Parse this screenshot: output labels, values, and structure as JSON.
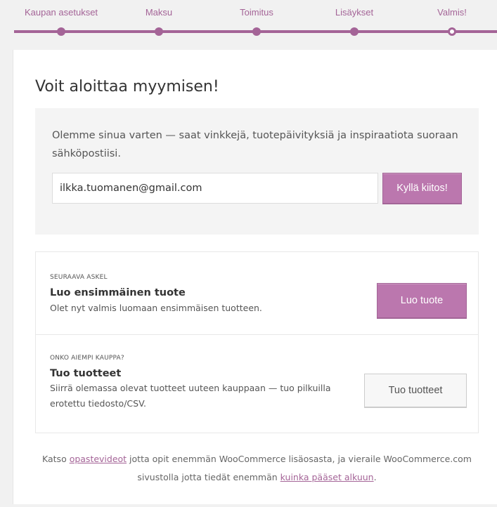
{
  "steps": [
    {
      "label": "Kaupan asetukset",
      "state": "done"
    },
    {
      "label": "Maksu",
      "state": "done"
    },
    {
      "label": "Toimitus",
      "state": "done"
    },
    {
      "label": "Lisäykset",
      "state": "done"
    },
    {
      "label": "Valmis!",
      "state": "current"
    }
  ],
  "page": {
    "title": "Voit aloittaa myymisen!"
  },
  "newsletter": {
    "text": "Olemme sinua varten — saat vinkkejä, tuotepäivityksiä ja inspiraatiota suoraan sähköpostiisi.",
    "email_value": "ilkka.tuomanen@gmail.com",
    "subscribe_label": "Kyllä kiitos!"
  },
  "next_steps": {
    "create_product": {
      "kicker": "Seuraava askel",
      "heading": "Luo ensimmäinen tuote",
      "description": "Olet nyt valmis luomaan ensimmäisen tuotteen.",
      "button_label": "Luo tuote"
    },
    "import_products": {
      "kicker": "Onko aiempi kauppa?",
      "heading": "Tuo tuotteet",
      "description": "Siirrä olemassa olevat tuotteet uuteen kauppaan — tuo pilkuilla erotettu tiedosto/CSV.",
      "button_label": "Tuo tuotteet"
    }
  },
  "footer": {
    "part1": "Katso ",
    "link1": "opastevideot",
    "part2": " jotta opit enemmän WooCommerce lisäosasta, ja vieraile WooCommerce.com sivustolla jotta tiedät enemmän ",
    "link2": "kuinka pääset alkuun",
    "part3": "."
  },
  "colors": {
    "accent": "#a46497",
    "button": "#bb77ae"
  }
}
